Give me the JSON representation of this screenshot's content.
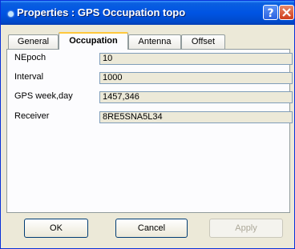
{
  "window": {
    "title": "Properties : GPS Occupation topo"
  },
  "titlebar_buttons": {
    "help_icon": "help-icon",
    "close_icon": "close-icon"
  },
  "tabs": [
    {
      "label": "General",
      "active": false
    },
    {
      "label": "Occupation",
      "active": true
    },
    {
      "label": "Antenna",
      "active": false
    },
    {
      "label": "Offset",
      "active": false
    }
  ],
  "fields": [
    {
      "label": "NEpoch",
      "value": "10"
    },
    {
      "label": "Interval",
      "value": "1000"
    },
    {
      "label": "GPS week,day",
      "value": "1457,346"
    },
    {
      "label": "Receiver",
      "value": "8RE5SNA5L34"
    }
  ],
  "buttons": {
    "ok": "OK",
    "cancel": "Cancel",
    "apply": "Apply"
  },
  "colors": {
    "titlebar": "#0054e3",
    "tab_highlight": "#ffc83c",
    "field_background": "#ece9d8"
  }
}
